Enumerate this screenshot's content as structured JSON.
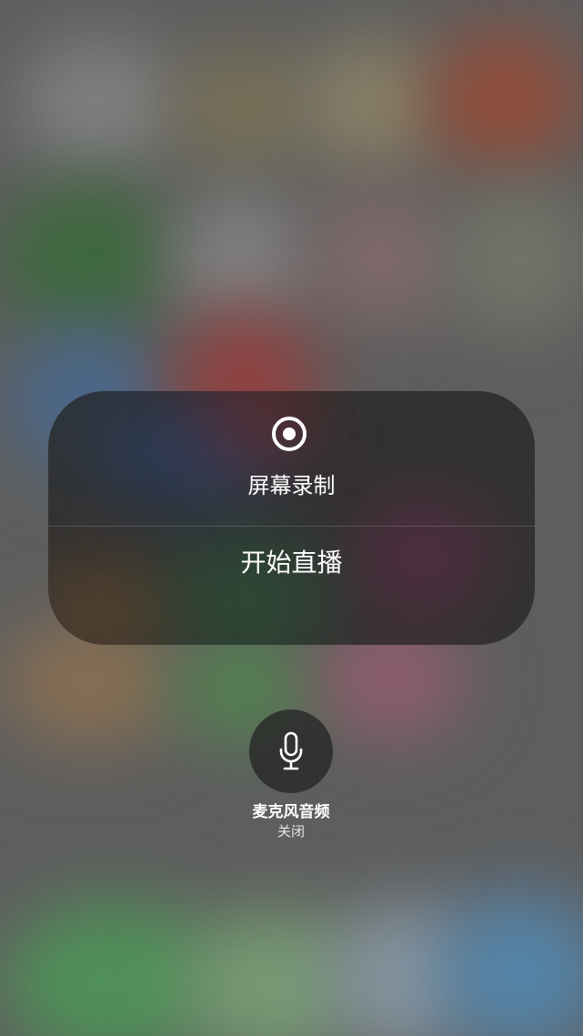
{
  "broadcast_picker": {
    "record_icon": "record-icon",
    "title": "屏幕录制",
    "start_broadcast_label": "开始直播"
  },
  "microphone": {
    "icon": "microphone-icon",
    "label": "麦克风音频",
    "status": "关闭"
  }
}
